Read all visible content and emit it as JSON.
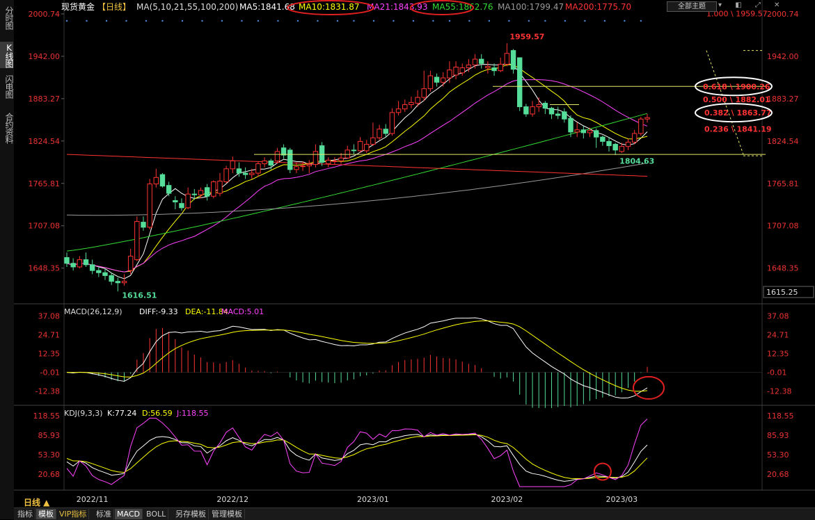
{
  "left_tabs": [
    {
      "label": "分时图",
      "active": false
    },
    {
      "label": "K线图",
      "active": true
    },
    {
      "label": "闪电图",
      "active": false
    },
    {
      "label": "合约资料",
      "active": false
    }
  ],
  "header": {
    "symbol": "现货黄金",
    "period": "【日线】",
    "ma_params": "MA(5,10,21,55,100,200)",
    "ma_values": [
      {
        "label": "MA5:1841.68",
        "color": "#ffffff"
      },
      {
        "label": "MA10:1831.87",
        "color": "#ffff00"
      },
      {
        "label": "MA21:1843.93",
        "color": "#ff44ff"
      },
      {
        "label": "MA55:1862.76",
        "color": "#33dd33"
      },
      {
        "label": "MA100:1799.47",
        "color": "#999999"
      },
      {
        "label": "MA200:1775.70",
        "color": "#ff3333"
      }
    ],
    "theme_button": "全部主题",
    "control_icons": "▾ ◧ ⤢ ✕"
  },
  "price_axis_left": [
    "2000.74",
    "1942.00",
    "1883.27",
    "1824.54",
    "1765.81",
    "1707.08",
    "1648.35"
  ],
  "price_axis_right": [
    "2000.74",
    "1942.00",
    "1883.27",
    "1824.54",
    "1765.81",
    "1707.08",
    "1648.35"
  ],
  "price_axis_extra": "1615.25",
  "annotations": {
    "high": "1959.57",
    "low": "1616.51",
    "recent_low": "1804.63",
    "fib_levels": [
      {
        "label": "0.618 \\ 1900.26",
        "value": 1900.26
      },
      {
        "label": "0.500 \\ 1882.01",
        "value": 1882.01
      },
      {
        "label": "0.382 \\ 1863.77",
        "value": 1863.77
      },
      {
        "label": "0.236 \\ 1841.19",
        "value": 1841.19
      }
    ]
  },
  "macd": {
    "title": "MACD(26,12,9)",
    "diff_label": "DIFF:-9.33",
    "dea_label": "DEA:-11.84",
    "macd_label": "MACD:5.01",
    "axis": [
      "37.08",
      "24.71",
      "12.35",
      "-0.01",
      "-12.38"
    ]
  },
  "kdj": {
    "title": "KDJ(9,3,3)",
    "k_label": "K:77.24",
    "d_label": "D:56.59",
    "j_label": "J:118.55",
    "axis": [
      "118.55",
      "85.93",
      "53.30",
      "20.68"
    ]
  },
  "x_labels": [
    "2022/11",
    "2022/12",
    "2023/01",
    "2023/02",
    "2023/03"
  ],
  "period_label": "日线 ▲",
  "bottom_tabs": [
    {
      "label": "指标",
      "active": false,
      "vip": false
    },
    {
      "label": "模板",
      "active": true,
      "vip": false
    },
    {
      "label": "VIP指标",
      "active": false,
      "vip": true
    },
    {
      "label": "标准",
      "active": false,
      "vip": false
    },
    {
      "label": "MACD",
      "active": true,
      "vip": false
    },
    {
      "label": "BOLL",
      "active": false,
      "vip": false
    },
    {
      "label": "另存模板",
      "active": false,
      "vip": false
    },
    {
      "label": "管理模板",
      "active": false,
      "vip": false
    }
  ],
  "colors": {
    "up": "#ff3333",
    "down": "#55dd99",
    "ma5": "#ffffff",
    "ma10": "#ffff00",
    "ma21": "#ff44ff",
    "ma55": "#33dd33",
    "ma100": "#999999",
    "ma200": "#ff3333",
    "annotation_red": "#ff3333",
    "annotation_green": "#55dd99"
  },
  "chart_data": {
    "type": "candlestick",
    "dates": [
      "2022-10-27",
      "2022-10-28",
      "2022-10-31",
      "2022-11-01",
      "2022-11-02",
      "2022-11-03",
      "2022-11-04",
      "2022-11-07",
      "2022-11-08",
      "2022-11-09",
      "2022-11-10",
      "2022-11-11",
      "2022-11-14",
      "2022-11-15",
      "2022-11-16",
      "2022-11-17",
      "2022-11-18",
      "2022-11-21",
      "2022-11-22",
      "2022-11-23",
      "2022-11-24",
      "2022-11-25",
      "2022-11-28",
      "2022-11-29",
      "2022-11-30",
      "2022-12-01",
      "2022-12-02",
      "2022-12-05",
      "2022-12-06",
      "2022-12-07",
      "2022-12-08",
      "2022-12-09",
      "2022-12-12",
      "2022-12-13",
      "2022-12-14",
      "2022-12-15",
      "2022-12-16",
      "2022-12-19",
      "2022-12-20",
      "2022-12-21",
      "2022-12-22",
      "2022-12-23",
      "2022-12-26",
      "2022-12-27",
      "2022-12-28",
      "2022-12-29",
      "2022-12-30",
      "2023-01-02",
      "2023-01-03",
      "2023-01-04",
      "2023-01-05",
      "2023-01-06",
      "2023-01-09",
      "2023-01-10",
      "2023-01-11",
      "2023-01-12",
      "2023-01-13",
      "2023-01-16",
      "2023-01-17",
      "2023-01-18",
      "2023-01-19",
      "2023-01-20",
      "2023-01-23",
      "2023-01-24",
      "2023-01-25",
      "2023-01-26",
      "2023-01-27",
      "2023-01-30",
      "2023-01-31",
      "2023-02-01",
      "2023-02-02",
      "2023-02-03",
      "2023-02-06",
      "2023-02-07",
      "2023-02-08",
      "2023-02-09",
      "2023-02-10",
      "2023-02-13",
      "2023-02-14",
      "2023-02-15",
      "2023-02-16",
      "2023-02-17",
      "2023-02-20",
      "2023-02-21",
      "2023-02-22",
      "2023-02-23",
      "2023-02-24",
      "2023-02-27",
      "2023-02-28",
      "2023-03-01",
      "2023-03-02",
      "2023-03-03"
    ],
    "open": [
      1663,
      1655,
      1650,
      1660,
      1653,
      1645,
      1642,
      1638,
      1630,
      1628,
      1645,
      1660,
      1712,
      1705,
      1765,
      1778,
      1763,
      1742,
      1738,
      1732,
      1751,
      1750,
      1760,
      1748,
      1752,
      1768,
      1786,
      1786,
      1780,
      1778,
      1780,
      1793,
      1797,
      1797,
      1815,
      1812,
      1785,
      1789,
      1790,
      1792,
      1818,
      1793,
      1796,
      1797,
      1801,
      1812,
      1811,
      1811,
      1820,
      1829,
      1841,
      1835,
      1864,
      1869,
      1875,
      1877,
      1885,
      1897,
      1913,
      1906,
      1912,
      1916,
      1919,
      1926,
      1930,
      1938,
      1926,
      1926,
      1922,
      1931,
      1950,
      1940,
      1872,
      1862,
      1872,
      1877,
      1870,
      1862,
      1865,
      1856,
      1837,
      1840,
      1836,
      1839,
      1830,
      1824,
      1820,
      1810,
      1817,
      1823,
      1835,
      1855
    ],
    "close": [
      1655,
      1650,
      1660,
      1653,
      1645,
      1642,
      1638,
      1630,
      1628,
      1630,
      1665,
      1713,
      1705,
      1765,
      1774,
      1762,
      1752,
      1740,
      1732,
      1751,
      1750,
      1756,
      1748,
      1768,
      1769,
      1786,
      1797,
      1780,
      1778,
      1780,
      1793,
      1797,
      1791,
      1810,
      1805,
      1785,
      1789,
      1790,
      1792,
      1810,
      1795,
      1798,
      1797,
      1801,
      1812,
      1811,
      1824,
      1820,
      1829,
      1841,
      1835,
      1864,
      1869,
      1875,
      1878,
      1885,
      1897,
      1915,
      1906,
      1912,
      1923,
      1927,
      1926,
      1930,
      1938,
      1932,
      1928,
      1922,
      1931,
      1946,
      1924,
      1872,
      1862,
      1872,
      1875,
      1870,
      1862,
      1860,
      1855,
      1837,
      1840,
      1836,
      1839,
      1830,
      1824,
      1818,
      1812,
      1817,
      1823,
      1835,
      1855,
      1857
    ],
    "high": [
      1670,
      1662,
      1665,
      1670,
      1660,
      1650,
      1648,
      1642,
      1635,
      1640,
      1675,
      1720,
      1720,
      1772,
      1786,
      1780,
      1768,
      1748,
      1745,
      1760,
      1758,
      1760,
      1765,
      1770,
      1780,
      1790,
      1803,
      1795,
      1788,
      1786,
      1796,
      1802,
      1800,
      1815,
      1820,
      1815,
      1795,
      1796,
      1798,
      1820,
      1823,
      1802,
      1802,
      1808,
      1818,
      1820,
      1830,
      1826,
      1850,
      1847,
      1848,
      1870,
      1880,
      1882,
      1886,
      1895,
      1922,
      1922,
      1918,
      1920,
      1935,
      1935,
      1932,
      1938,
      1945,
      1945,
      1935,
      1932,
      1940,
      1960,
      1952,
      1880,
      1876,
      1880,
      1885,
      1880,
      1872,
      1872,
      1870,
      1860,
      1850,
      1845,
      1843,
      1842,
      1832,
      1830,
      1822,
      1822,
      1828,
      1840,
      1858,
      1862
    ],
    "low": [
      1650,
      1645,
      1648,
      1650,
      1640,
      1636,
      1632,
      1625,
      1616,
      1624,
      1640,
      1658,
      1700,
      1702,
      1760,
      1760,
      1748,
      1730,
      1728,
      1730,
      1743,
      1745,
      1742,
      1745,
      1748,
      1766,
      1780,
      1775,
      1772,
      1772,
      1775,
      1788,
      1785,
      1793,
      1800,
      1780,
      1780,
      1783,
      1780,
      1788,
      1790,
      1788,
      1792,
      1793,
      1800,
      1806,
      1808,
      1808,
      1818,
      1826,
      1830,
      1832,
      1860,
      1865,
      1870,
      1872,
      1880,
      1893,
      1900,
      1900,
      1905,
      1910,
      1915,
      1920,
      1925,
      1925,
      1918,
      1915,
      1920,
      1928,
      1918,
      1866,
      1858,
      1858,
      1865,
      1862,
      1855,
      1855,
      1850,
      1830,
      1830,
      1828,
      1830,
      1815,
      1818,
      1810,
      1805,
      1808,
      1812,
      1820,
      1832,
      1850
    ],
    "macd": {
      "diff_last": -9.33,
      "dea_last": -11.84,
      "hist_last": 5.01,
      "ylim": [
        -18,
        40
      ]
    },
    "kdj": {
      "k_last": 77.24,
      "d_last": 56.59,
      "j_last": 118.55
    },
    "ma_last": {
      "ma5": 1841.68,
      "ma10": 1831.87,
      "ma21": 1843.93,
      "ma55": 1862.76,
      "ma100": 1799.47,
      "ma200": 1775.7
    },
    "ylim": [
      1615.25,
      2000.74
    ],
    "fib": {
      "high": 1959.57,
      "low": 1804.63
    }
  }
}
